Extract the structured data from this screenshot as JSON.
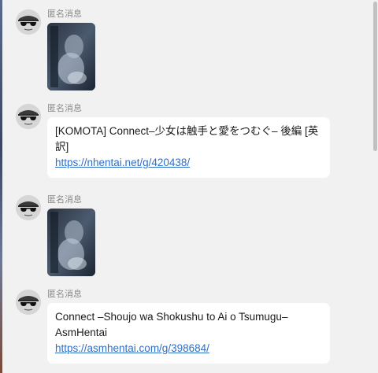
{
  "messages": [
    {
      "sender": "匿名消息",
      "type": "image",
      "image_alt": "dark blurry photo"
    },
    {
      "sender": "匿名消息",
      "type": "text",
      "text": "[KOMOTA] Connect–少女は触手と愛をつむぐ– 後編 [英訳]",
      "link": "https://nhentai.net/g/420438/"
    },
    {
      "sender": "匿名消息",
      "type": "image",
      "image_alt": "dark blurry photo"
    },
    {
      "sender": "匿名消息",
      "type": "text",
      "text": "Connect –Shoujo wa Shokushu to Ai o Tsumugu– AsmHentai",
      "link": "https://asmhentai.com/g/398684/"
    }
  ],
  "colors": {
    "background": "#f1f1f1",
    "bubble": "#ffffff",
    "link": "#2f6ec5",
    "sender": "#8a8a8a"
  },
  "icons": {
    "avatar": "anonymous-sunglasses-avatar-icon"
  }
}
